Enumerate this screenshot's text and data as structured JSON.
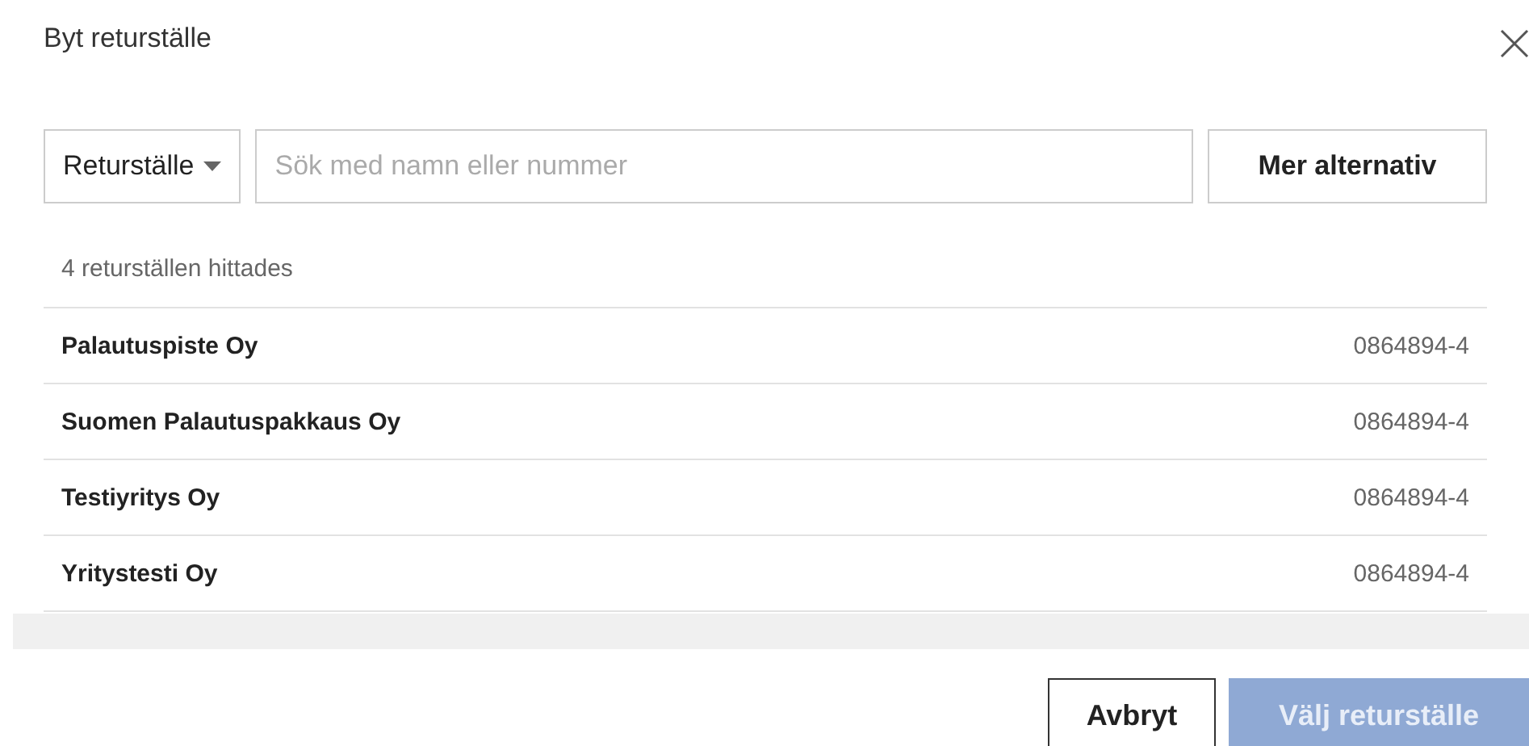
{
  "dialog": {
    "title": "Byt returställe"
  },
  "filter": {
    "dropdown": "Returställe",
    "search": {
      "placeholder": "Sök med namn eller nummer"
    },
    "more_button": "Mer alternativ"
  },
  "result_count": "4 returställen hittades",
  "results": [
    {
      "name": "Palautuspiste Oy",
      "number": "0864894-4"
    },
    {
      "name": "Suomen Palautuspakkaus Oy",
      "number": "0864894-4"
    },
    {
      "name": "Testiyritys Oy",
      "number": "0864894-4"
    },
    {
      "name": "Yritystesti Oy",
      "number": "0864894-4"
    }
  ],
  "buttons": [
    {
      "label": "Avbryt",
      "kind": "secondary",
      "disabled": false
    },
    {
      "label": "Välj returställe",
      "kind": "primary",
      "disabled": true
    }
  ]
}
